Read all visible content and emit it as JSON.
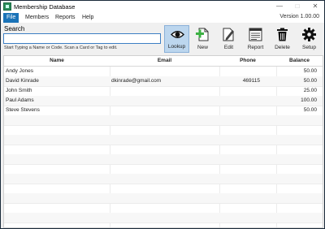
{
  "window": {
    "title": "Membership Database",
    "version": "Version 1.00.00"
  },
  "window_controls": {
    "minimize": "—",
    "maximize": "□",
    "close": "✕"
  },
  "menu": [
    "File",
    "Members",
    "Reports",
    "Help"
  ],
  "search": {
    "label": "Search",
    "value": "",
    "hint": "Start Typing a Name or Code. Scan a Card or Tag to edit."
  },
  "toolbar": [
    {
      "label": "Lookup",
      "icon": "eye-icon",
      "selected": true
    },
    {
      "label": "New",
      "icon": "new-document-icon",
      "selected": false
    },
    {
      "label": "Edit",
      "icon": "edit-pencil-icon",
      "selected": false
    },
    {
      "label": "Report",
      "icon": "report-icon",
      "selected": false
    },
    {
      "label": "Delete",
      "icon": "trash-icon",
      "selected": false
    },
    {
      "label": "Setup",
      "icon": "gear-icon",
      "selected": false
    }
  ],
  "table": {
    "columns": [
      "Name",
      "Email",
      "Phone",
      "Balance"
    ],
    "rows": [
      [
        "Andy Jones",
        "",
        "",
        "50.00"
      ],
      [
        "David Kinrade",
        "dkinrade@gmail.com",
        "469115",
        "50.00"
      ],
      [
        "John Smith",
        "",
        "",
        "25.00"
      ],
      [
        "Paul Adams",
        "",
        "",
        "100.00"
      ],
      [
        "Steve Stevens",
        "",
        "",
        "50.00"
      ]
    ]
  },
  "colors": {
    "accent": "#1a73b8",
    "selected_button": "#bcd6ee",
    "new_icon": "#3cb043",
    "app_icon": "#2a8c5a"
  }
}
